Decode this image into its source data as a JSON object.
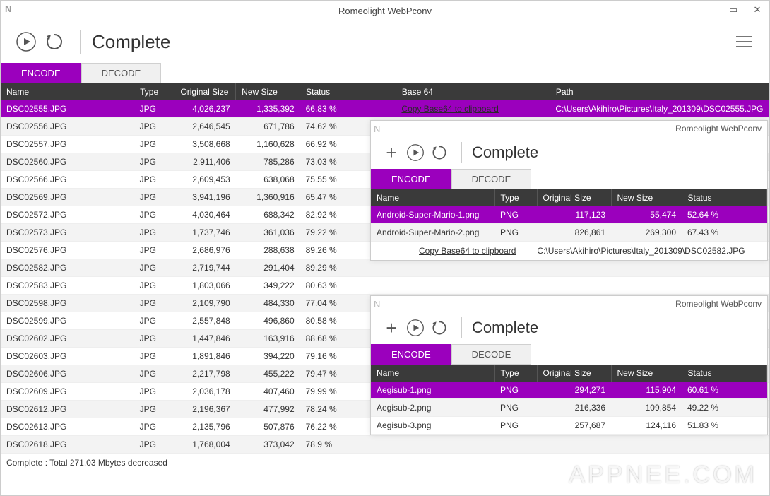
{
  "app_title": "Romeolight WebPconv",
  "main": {
    "status": "Complete",
    "tabs": {
      "encode": "ENCODE",
      "decode": "DECODE"
    },
    "headers": {
      "name": "Name",
      "type": "Type",
      "osize": "Original Size",
      "nsize": "New Size",
      "status": "Status",
      "base64": "Base 64",
      "path": "Path"
    },
    "copy_label": "Copy Base64 to clipboard",
    "selected_path": "C:\\Users\\Akihiro\\Pictures\\Italy_201309\\DSC02555.JPG",
    "rows": [
      {
        "name": "DSC02555.JPG",
        "type": "JPG",
        "osize": "4,026,237",
        "nsize": "1,335,392",
        "status": "66.83 %",
        "selected": true
      },
      {
        "name": "DSC02556.JPG",
        "type": "JPG",
        "osize": "2,646,545",
        "nsize": "671,786",
        "status": "74.62 %"
      },
      {
        "name": "DSC02557.JPG",
        "type": "JPG",
        "osize": "3,508,668",
        "nsize": "1,160,628",
        "status": "66.92 %"
      },
      {
        "name": "DSC02560.JPG",
        "type": "JPG",
        "osize": "2,911,406",
        "nsize": "785,286",
        "status": "73.03 %"
      },
      {
        "name": "DSC02566.JPG",
        "type": "JPG",
        "osize": "2,609,453",
        "nsize": "638,068",
        "status": "75.55 %"
      },
      {
        "name": "DSC02569.JPG",
        "type": "JPG",
        "osize": "3,941,196",
        "nsize": "1,360,916",
        "status": "65.47 %"
      },
      {
        "name": "DSC02572.JPG",
        "type": "JPG",
        "osize": "4,030,464",
        "nsize": "688,342",
        "status": "82.92 %"
      },
      {
        "name": "DSC02573.JPG",
        "type": "JPG",
        "osize": "1,737,746",
        "nsize": "361,036",
        "status": "79.22 %"
      },
      {
        "name": "DSC02576.JPG",
        "type": "JPG",
        "osize": "2,686,976",
        "nsize": "288,638",
        "status": "89.26 %"
      },
      {
        "name": "DSC02582.JPG",
        "type": "JPG",
        "osize": "2,719,744",
        "nsize": "291,404",
        "status": "89.29 %"
      },
      {
        "name": "DSC02583.JPG",
        "type": "JPG",
        "osize": "1,803,066",
        "nsize": "349,222",
        "status": "80.63 %"
      },
      {
        "name": "DSC02598.JPG",
        "type": "JPG",
        "osize": "2,109,790",
        "nsize": "484,330",
        "status": "77.04 %"
      },
      {
        "name": "DSC02599.JPG",
        "type": "JPG",
        "osize": "2,557,848",
        "nsize": "496,860",
        "status": "80.58 %"
      },
      {
        "name": "DSC02602.JPG",
        "type": "JPG",
        "osize": "1,447,846",
        "nsize": "163,916",
        "status": "88.68 %"
      },
      {
        "name": "DSC02603.JPG",
        "type": "JPG",
        "osize": "1,891,846",
        "nsize": "394,220",
        "status": "79.16 %"
      },
      {
        "name": "DSC02606.JPG",
        "type": "JPG",
        "osize": "2,217,798",
        "nsize": "455,222",
        "status": "79.47 %"
      },
      {
        "name": "DSC02609.JPG",
        "type": "JPG",
        "osize": "2,036,178",
        "nsize": "407,460",
        "status": "79.99 %"
      },
      {
        "name": "DSC02612.JPG",
        "type": "JPG",
        "osize": "2,196,367",
        "nsize": "477,992",
        "status": "78.24 %"
      },
      {
        "name": "DSC02613.JPG",
        "type": "JPG",
        "osize": "2,135,796",
        "nsize": "507,876",
        "status": "76.22 %"
      },
      {
        "name": "DSC02618.JPG",
        "type": "JPG",
        "osize": "1,768,004",
        "nsize": "373,042",
        "status": "78.9 %"
      }
    ],
    "footer": "Complete : Total 271.03 Mbytes decreased"
  },
  "sub1": {
    "status": "Complete",
    "headers": {
      "name": "Name",
      "type": "Type",
      "osize": "Original Size",
      "nsize": "New Size",
      "status": "Status"
    },
    "rows": [
      {
        "name": "Android-Super-Mario-1.png",
        "type": "PNG",
        "osize": "117,123",
        "nsize": "55,474",
        "status": "52.64 %",
        "selected": true
      },
      {
        "name": "Android-Super-Mario-2.png",
        "type": "PNG",
        "osize": "826,861",
        "nsize": "269,300",
        "status": "67.43 %"
      }
    ],
    "copy_label": "Copy Base64 to clipboard",
    "extra_path": "C:\\Users\\Akihiro\\Pictures\\Italy_201309\\DSC02582.JPG"
  },
  "sub2": {
    "status": "Complete",
    "headers": {
      "name": "Name",
      "type": "Type",
      "osize": "Original Size",
      "nsize": "New Size",
      "status": "Status"
    },
    "rows": [
      {
        "name": "Aegisub-1.png",
        "type": "PNG",
        "osize": "294,271",
        "nsize": "115,904",
        "status": "60.61 %",
        "selected": true
      },
      {
        "name": "Aegisub-2.png",
        "type": "PNG",
        "osize": "216,336",
        "nsize": "109,854",
        "status": "49.22 %"
      },
      {
        "name": "Aegisub-3.png",
        "type": "PNG",
        "osize": "257,687",
        "nsize": "124,116",
        "status": "51.83 %"
      }
    ]
  },
  "watermark": "APPNEE.COM"
}
